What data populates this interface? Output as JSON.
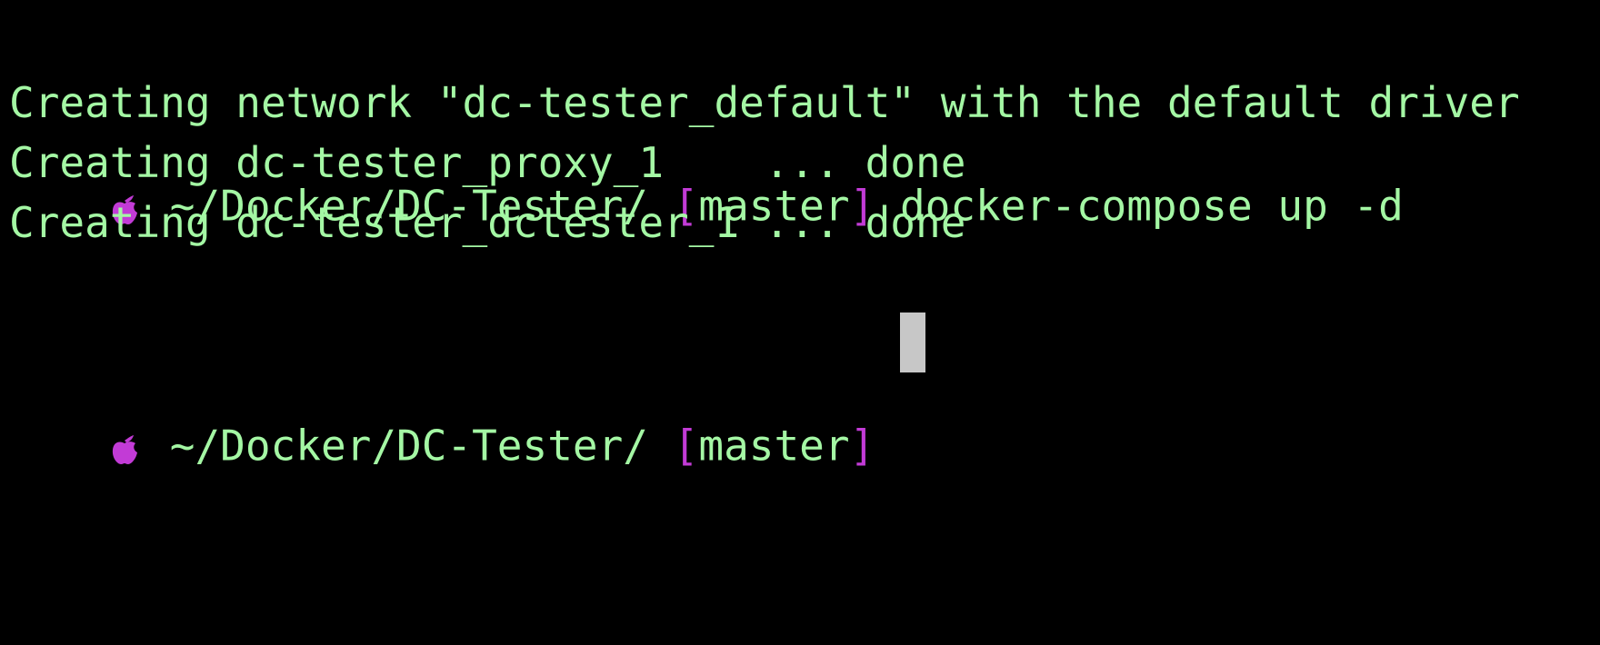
{
  "terminal": {
    "colors": {
      "background": "#000000",
      "text": "#a4f7a4",
      "prompt_bracket": "#c23bd6",
      "apple_icon": "#c23bd6",
      "cursor": "#c7c7c7"
    },
    "prompt": {
      "icon": "apple-icon",
      "path": "~/Docker/DC-Tester/",
      "bracket_open": "[",
      "branch": "master",
      "bracket_close": "]"
    },
    "command": "docker-compose up -d",
    "output": [
      "Creating network \"dc-tester_default\" with the default driver",
      "Creating dc-tester_proxy_1    ... done",
      "Creating dc-tester_dctester_1 ... done"
    ]
  }
}
